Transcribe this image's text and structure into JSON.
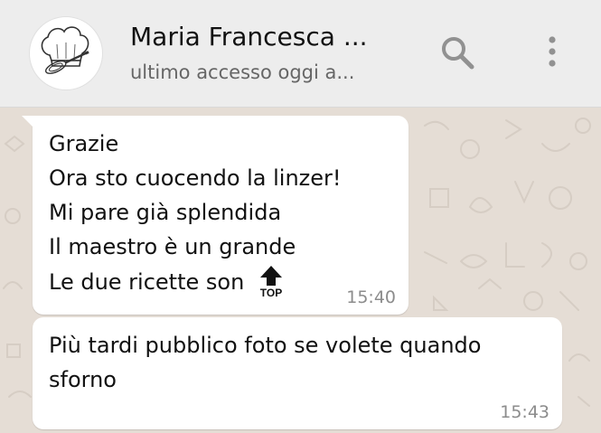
{
  "header": {
    "contact_name": "Maria Francesca ...",
    "status": "ultimo accesso oggi a...",
    "avatar_icon": "chef-hat-whisk-icon",
    "search_icon": "search-icon",
    "menu_icon": "more-vert-icon"
  },
  "messages": [
    {
      "lines": [
        "Grazie",
        "Ora sto cuocendo la linzer!",
        "Mi pare già splendida",
        "Il maestro è un grande",
        "Le due ricette son"
      ],
      "emoji": "top-arrow-emoji",
      "emoji_text": "TOP",
      "time": "15:40"
    },
    {
      "text": "Più tardi pubblico foto se volete quando sforno",
      "time": "15:43"
    }
  ],
  "colors": {
    "header_bg": "#ededed",
    "chat_bg": "#e5ddd5",
    "bubble_bg": "#ffffff",
    "icon_gray": "#919191"
  }
}
